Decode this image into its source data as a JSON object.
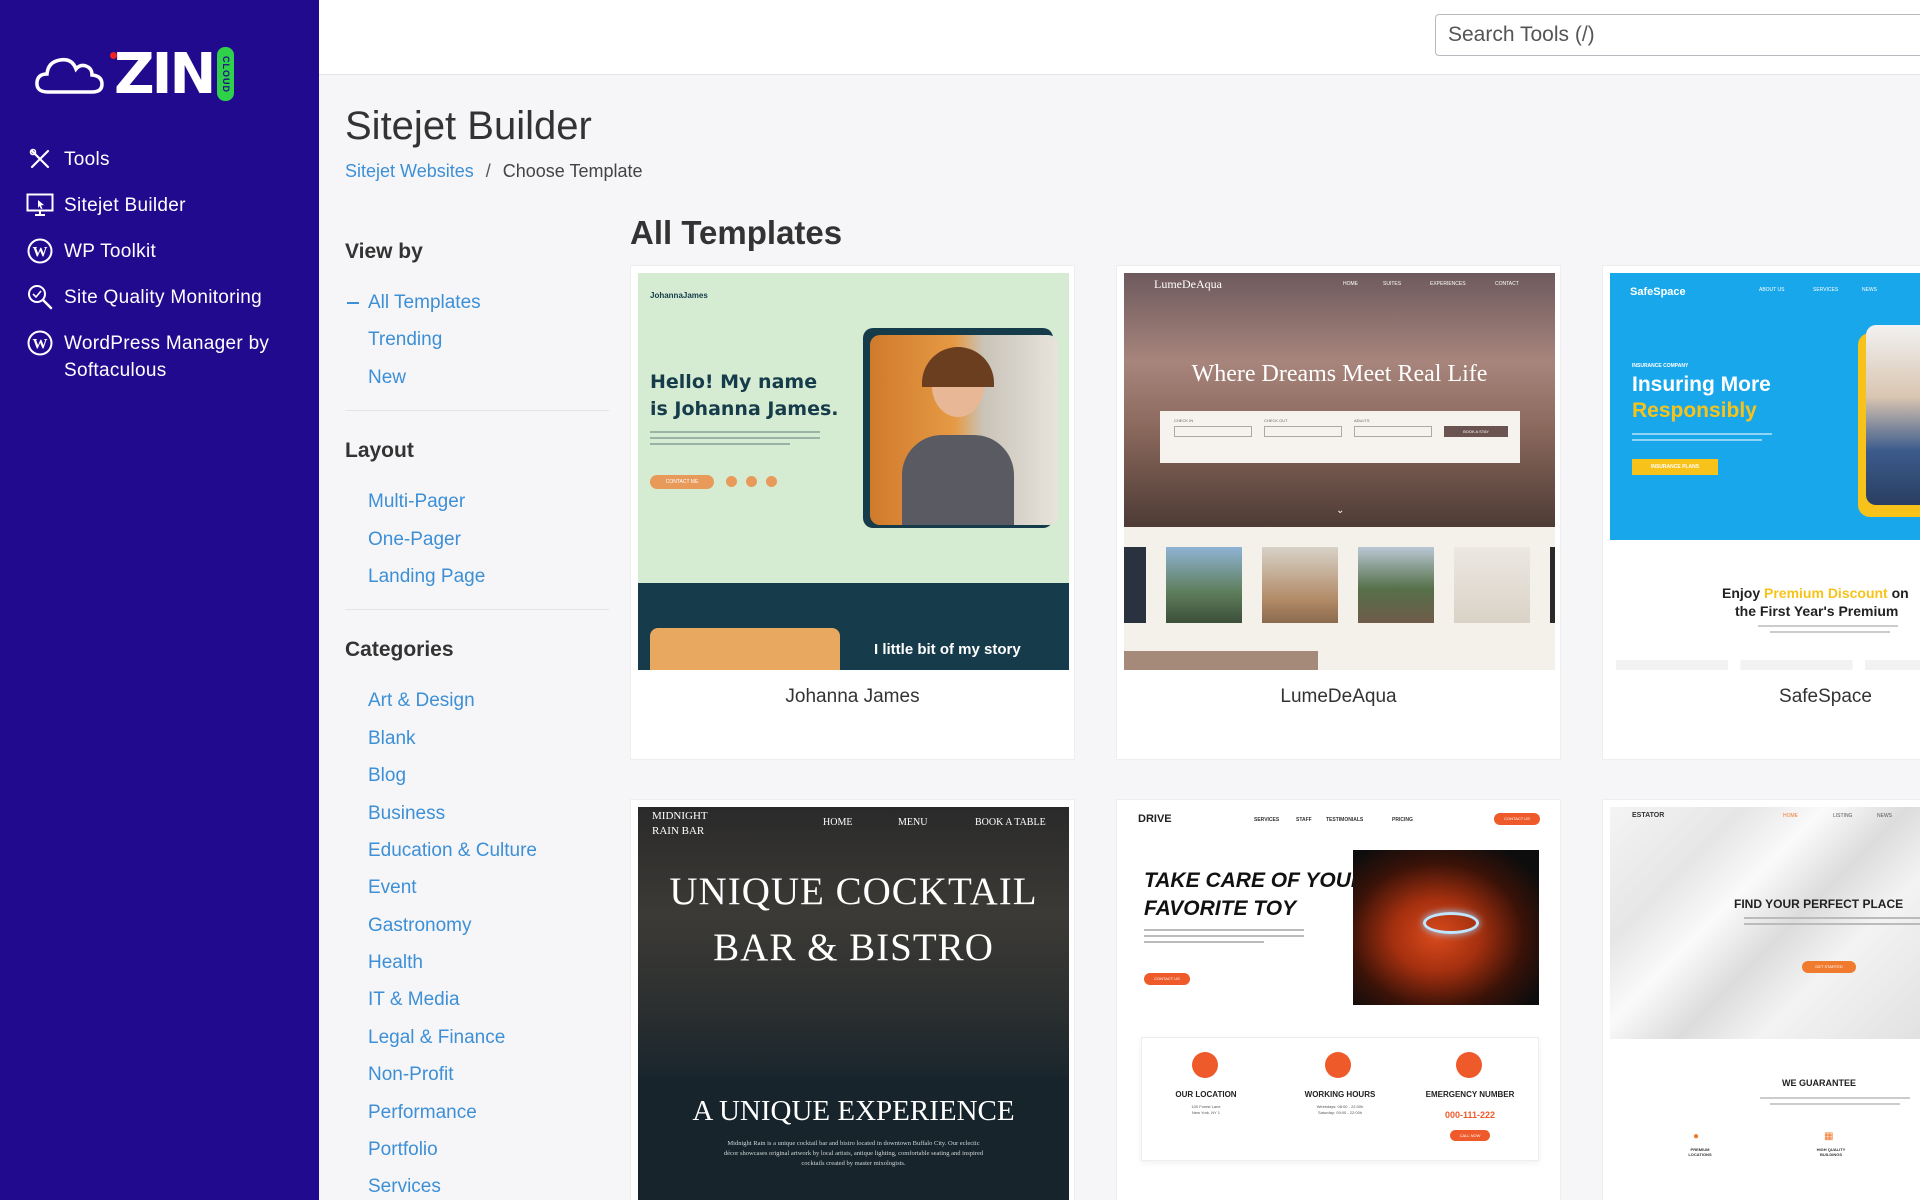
{
  "sidebar": {
    "logo_text": "ZIN",
    "logo_badge": "CLOUD",
    "items": [
      {
        "label": "Tools",
        "icon": "tools-icon"
      },
      {
        "label": "Sitejet Builder",
        "icon": "monitor-icon"
      },
      {
        "label": "WP Toolkit",
        "icon": "wordpress-icon"
      },
      {
        "label": "Site Quality Monitoring",
        "icon": "magnifier-icon"
      },
      {
        "label": "WordPress Manager by Softaculous",
        "icon": "wordpress-icon"
      }
    ]
  },
  "header": {
    "search_placeholder": "Search Tools (/)"
  },
  "page": {
    "title": "Sitejet Builder",
    "breadcrumb": {
      "link": "Sitejet Websites",
      "separator": "/",
      "current": "Choose Template"
    },
    "templates_title": "All Templates"
  },
  "filters": {
    "view_by": {
      "heading": "View by",
      "items": [
        "All Templates",
        "Trending",
        "New"
      ],
      "active": "All Templates"
    },
    "layout": {
      "heading": "Layout",
      "items": [
        "Multi-Pager",
        "One-Pager",
        "Landing Page"
      ]
    },
    "categories": {
      "heading": "Categories",
      "items": [
        "Art & Design",
        "Blank",
        "Blog",
        "Business",
        "Education & Culture",
        "Event",
        "Gastronomy",
        "Health",
        "IT & Media",
        "Legal & Finance",
        "Non-Profit",
        "Performance",
        "Portfolio",
        "Services"
      ]
    }
  },
  "templates": [
    {
      "name": "Johanna James",
      "preview": {
        "brand": "JohannaJames",
        "headline": "Hello! My name is Johanna James.",
        "button": "CONTACT ME",
        "story": "I little bit of my story",
        "colors": {
          "bg": "#d5ecd2",
          "dark": "#163b4a",
          "accent": "#e89a5a"
        }
      }
    },
    {
      "name": "LumeDeAqua",
      "preview": {
        "brand": "LumeDeAqua",
        "nav": [
          "HOME",
          "SUITES",
          "EXPERIENCES",
          "CONTACT"
        ],
        "headline": "Where Dreams Meet Real Life",
        "fields": [
          "CHECK IN",
          "CHECK OUT",
          "ADULTS"
        ],
        "button": "BOOK A STAY"
      }
    },
    {
      "name": "SafeSpace",
      "preview": {
        "brand": "SafeSpace",
        "nav": [
          "ABOUT US",
          "SERVICES",
          "NEWS"
        ],
        "kicker": "INSURANCE COMPANY",
        "headline_1": "Insuring More",
        "headline_2": "Responsibly",
        "button": "INSURANCE PLANS",
        "promo_1": "Enjoy",
        "promo_highlight": "Premium Discount",
        "promo_2": "on",
        "promo_3": "the First Year's Premium",
        "colors": {
          "blue": "#18a7ea",
          "yellow": "#f7c31b"
        }
      }
    },
    {
      "name": "Midnight Rain Bar",
      "preview": {
        "brand_1": "MIDNIGHT",
        "brand_2": "RAIN BAR",
        "nav": [
          "HOME",
          "MENU",
          "BOOK A TABLE"
        ],
        "headline_1": "UNIQUE COCKTAIL",
        "headline_2": "BAR & BISTRO",
        "subhead": "A UNIQUE EXPERIENCE",
        "body": "Midnight Rain is a unique cocktail bar and bistro located in downtown Buffalo City. Our eclectic décor showcases original artwork by local artists, antique lighting, comfortable seating and inspired cocktails created by master mixologists."
      }
    },
    {
      "name": "Drive",
      "preview": {
        "brand": "DRIVE",
        "nav": [
          "SERVICES",
          "STAFF",
          "TESTIMONIALS",
          "PRICING"
        ],
        "nav_button": "CONTACT US",
        "headline_1": "TAKE CARE OF YOUR",
        "headline_2": "FAVORITE TOY",
        "button": "CONTACT US",
        "features": [
          {
            "title": "OUR LOCATION",
            "line_1": "100 Forest Lane",
            "line_2": "New York, NY 1"
          },
          {
            "title": "WORKING HOURS",
            "line_1": "Weekdays: 08:00 - 22:00h",
            "line_2": "Saturday: 09:00 - 22:00h"
          },
          {
            "title": "EMERGENCY NUMBER",
            "line_1": "000-111-222",
            "line_2": "CALL NOW"
          }
        ],
        "colors": {
          "accent": "#ee5a2a"
        }
      }
    },
    {
      "name": "Estator",
      "preview": {
        "brand": "ESTATOR",
        "nav": [
          "HOME",
          "LISTING",
          "NEWS"
        ],
        "headline": "FIND YOUR PERFECT PLACE",
        "button": "GET STARTED",
        "guarantee": "WE GUARANTEE",
        "features": [
          "PREMIUM LOCATIONS",
          "HIGH QUALITY BUILDINGS"
        ]
      }
    }
  ]
}
